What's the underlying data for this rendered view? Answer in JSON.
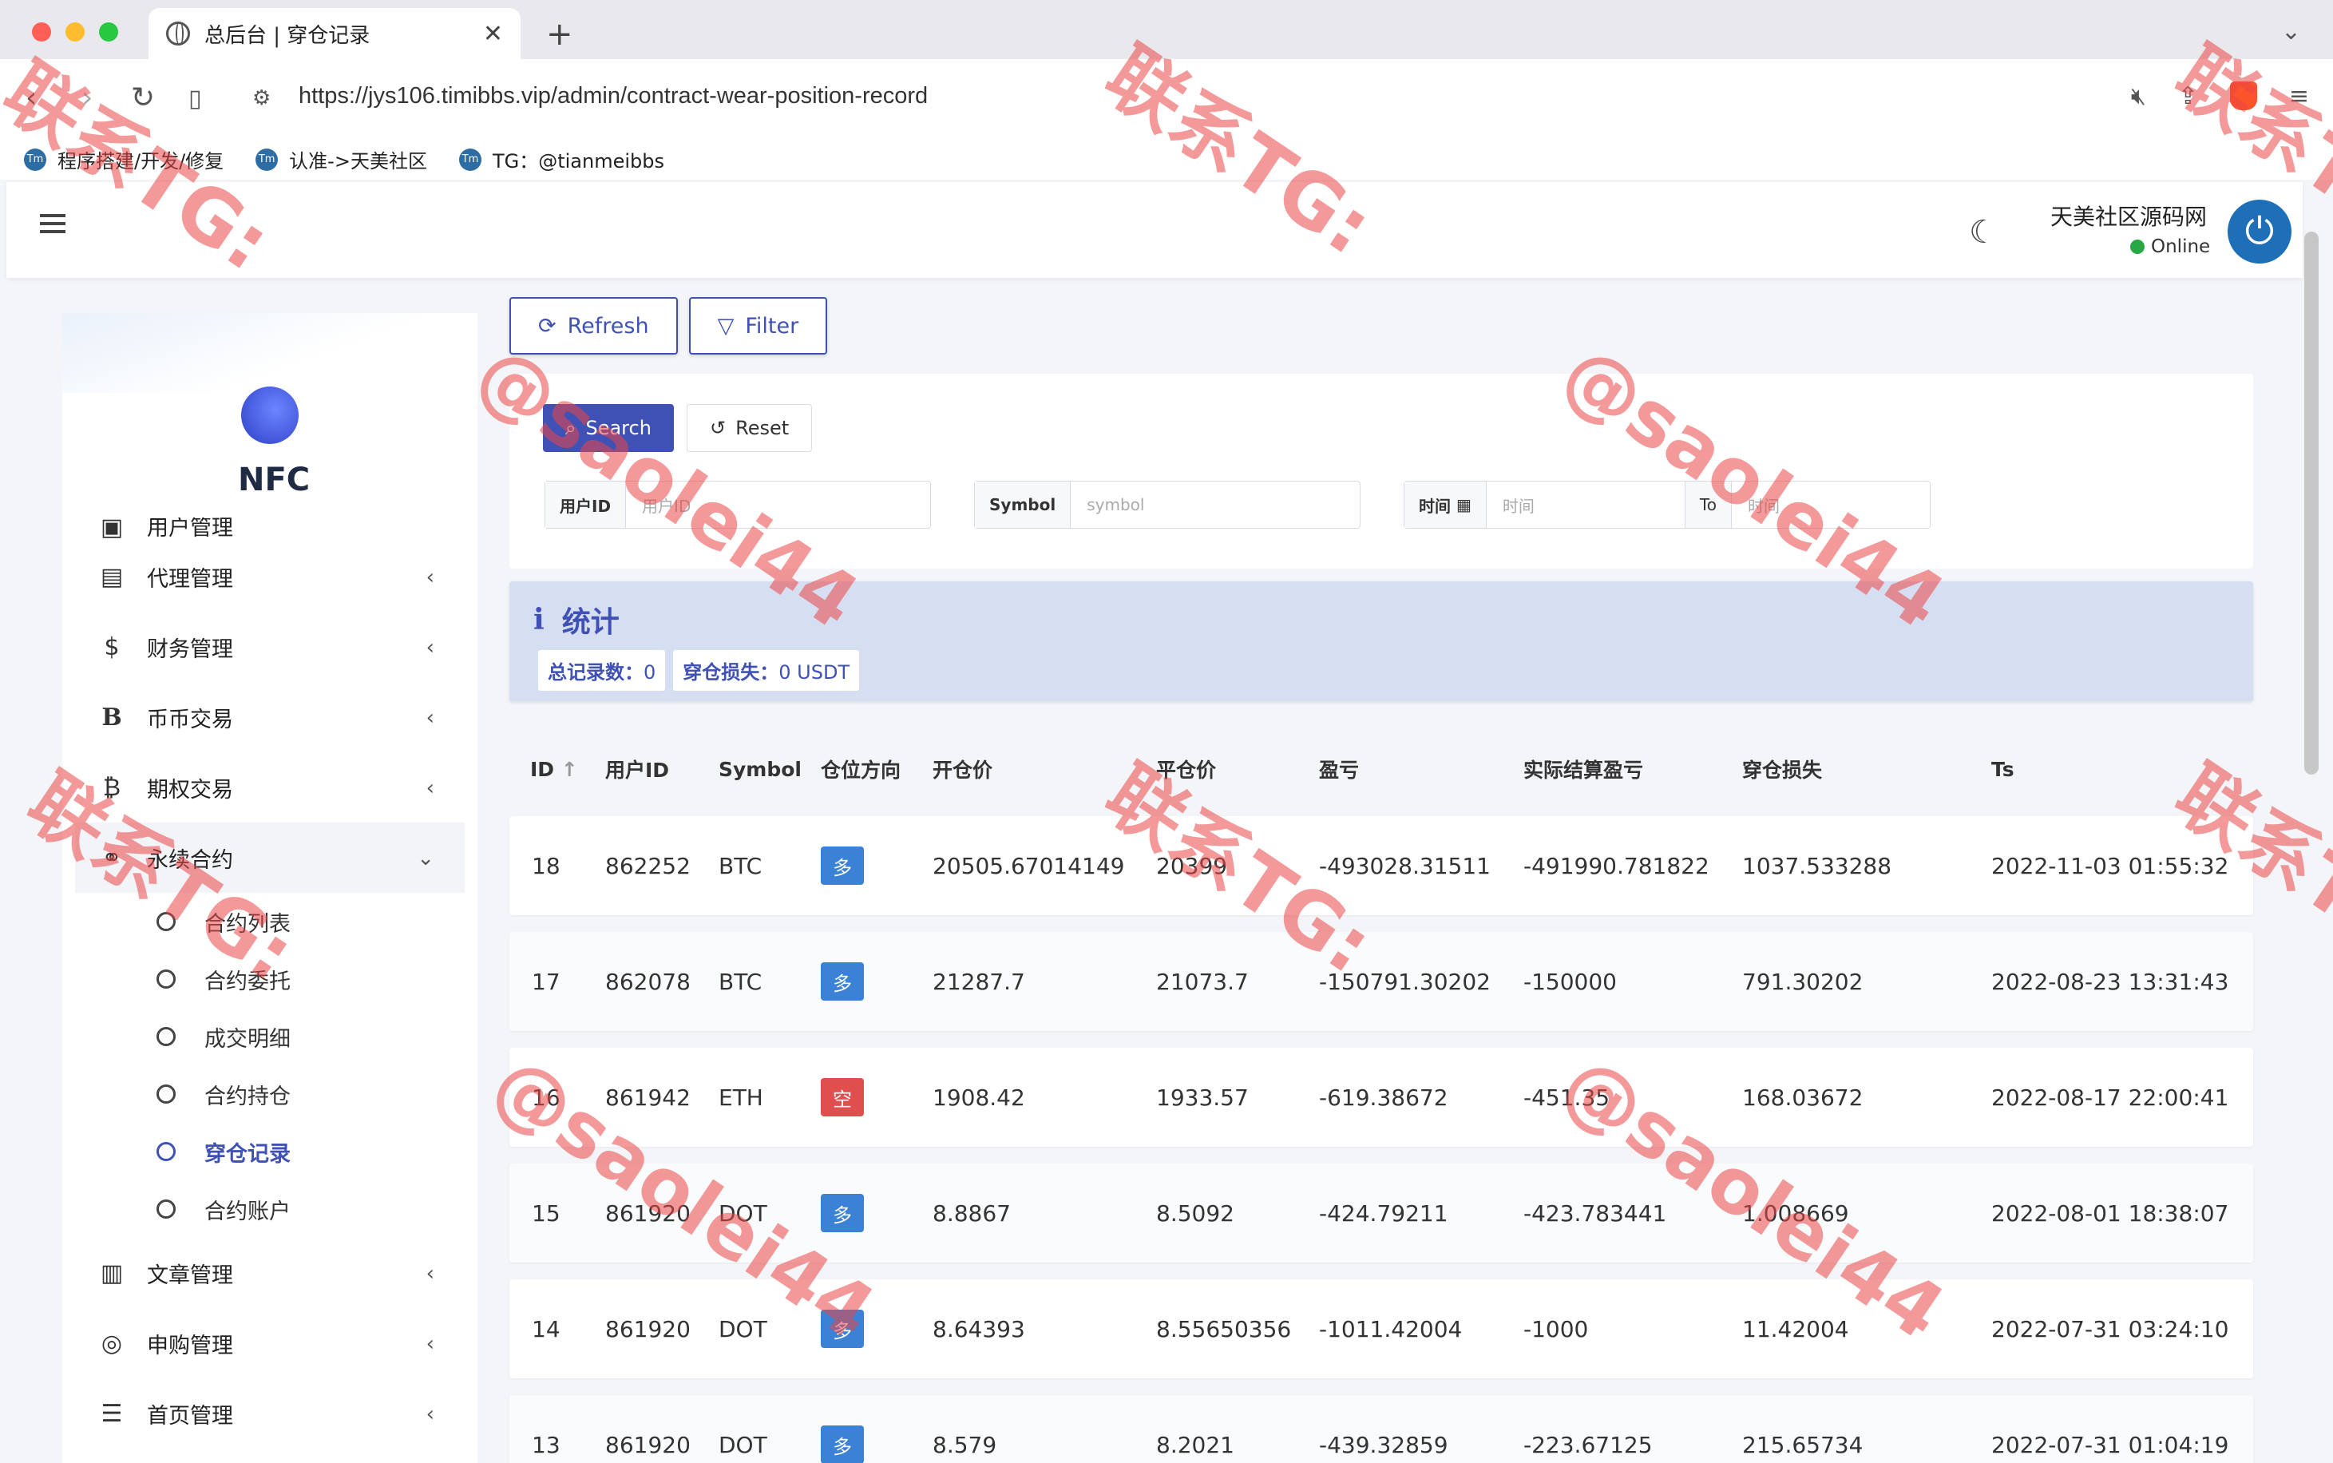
{
  "browser": {
    "tab_title": "总后台 | 穿仓记录",
    "url": "https://jys106.timibbs.vip/admin/contract-wear-position-record",
    "bookmarks": [
      {
        "label": "程序搭建/开发/修复"
      },
      {
        "label": "认准->天美社区"
      },
      {
        "label": "TG：@tianmeibbs"
      }
    ]
  },
  "header": {
    "site_name": "天美社区源码网",
    "status": "Online"
  },
  "sidebar": {
    "logo_text": "NFC",
    "partial_item": "用户管理",
    "items": [
      {
        "label": "代理管理",
        "icon": "agent-card-icon"
      },
      {
        "label": "财务管理",
        "icon": "dollar-icon"
      },
      {
        "label": "币币交易",
        "icon": "bitcoin-b-icon"
      },
      {
        "label": "期权交易",
        "icon": "bitcoin-icon"
      },
      {
        "label": "永续合约",
        "icon": "link-icon"
      }
    ],
    "submenu": [
      {
        "label": "合约列表"
      },
      {
        "label": "合约委托"
      },
      {
        "label": "成交明细"
      },
      {
        "label": "合约持仓"
      },
      {
        "label": "穿仓记录"
      },
      {
        "label": "合约账户"
      }
    ],
    "items_after": [
      {
        "label": "文章管理",
        "icon": "newspaper-icon"
      },
      {
        "label": "申购管理",
        "icon": "lifebuoy-icon"
      },
      {
        "label": "首页管理",
        "icon": "list-icon"
      }
    ]
  },
  "toolbar": {
    "refresh_label": "Refresh",
    "filter_label": "Filter"
  },
  "search": {
    "search_label": "Search",
    "reset_label": "Reset",
    "user_id_label": "用户ID",
    "user_id_placeholder": "用户ID",
    "symbol_label": "Symbol",
    "symbol_placeholder": "symbol",
    "time_label": "时间",
    "time_placeholder": "时间",
    "to_label": "To",
    "time_to_placeholder": "时间"
  },
  "stats": {
    "title": "统计",
    "total_label": "总记录数：",
    "total_value": "0",
    "loss_label": "穿仓损失：",
    "loss_value": "0 USDT"
  },
  "table": {
    "columns": [
      "ID",
      "用户ID",
      "Symbol",
      "仓位方向",
      "开仓价",
      "平仓价",
      "盈亏",
      "实际结算盈亏",
      "穿仓损失",
      "Ts"
    ],
    "rows": [
      {
        "id": "18",
        "uid": "862252",
        "symbol": "BTC",
        "dir": "多",
        "open": "20505.67014149",
        "close": "20399",
        "pnl": "-493028.31511",
        "real": "-491990.781822",
        "loss": "1037.533288",
        "ts": "2022-11-03 01:55:32"
      },
      {
        "id": "17",
        "uid": "862078",
        "symbol": "BTC",
        "dir": "多",
        "open": "21287.7",
        "close": "21073.7",
        "pnl": "-150791.30202",
        "real": "-150000",
        "loss": "791.30202",
        "ts": "2022-08-23 13:31:43"
      },
      {
        "id": "16",
        "uid": "861942",
        "symbol": "ETH",
        "dir": "空",
        "open": "1908.42",
        "close": "1933.57",
        "pnl": "-619.38672",
        "real": "-451.35",
        "loss": "168.03672",
        "ts": "2022-08-17 22:00:41"
      },
      {
        "id": "15",
        "uid": "861920",
        "symbol": "DOT",
        "dir": "多",
        "open": "8.8867",
        "close": "8.5092",
        "pnl": "-424.79211",
        "real": "-423.783441",
        "loss": "1.008669",
        "ts": "2022-08-01 18:38:07"
      },
      {
        "id": "14",
        "uid": "861920",
        "symbol": "DOT",
        "dir": "多",
        "open": "8.64393",
        "close": "8.55650356",
        "pnl": "-1011.42004",
        "real": "-1000",
        "loss": "11.42004",
        "ts": "2022-07-31 03:24:10"
      },
      {
        "id": "13",
        "uid": "861920",
        "symbol": "DOT",
        "dir": "多",
        "open": "8.579",
        "close": "8.2021",
        "pnl": "-439.32859",
        "real": "-223.67125",
        "loss": "215.65734",
        "ts": "2022-07-31 01:04:19"
      }
    ]
  },
  "watermark": {
    "line1": "联系TG:",
    "line2": "@saolei44"
  },
  "colors": {
    "accent": "#3f51b5",
    "long": "#3b82d6",
    "short": "#e04e4e",
    "watermark": "#eb4646"
  }
}
